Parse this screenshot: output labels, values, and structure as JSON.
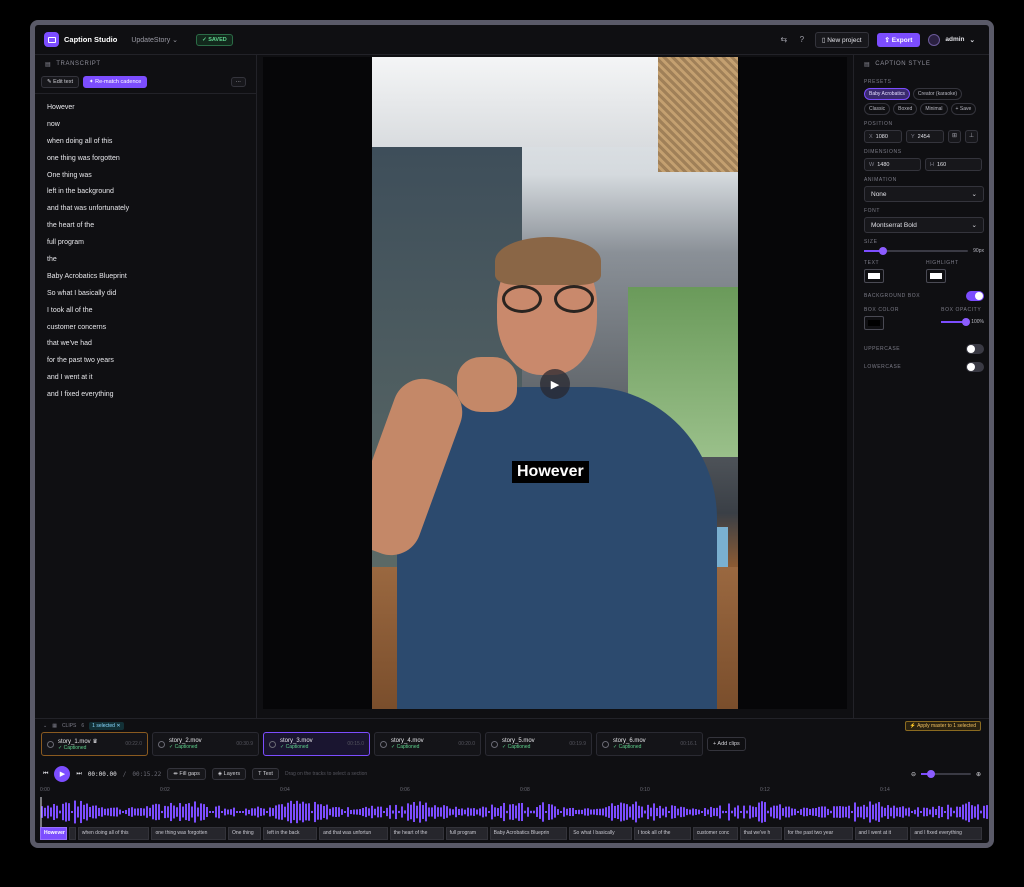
{
  "app": {
    "name": "Caption Studio",
    "project": "UpdateStory ⌄",
    "saved": "✓ SAVED"
  },
  "topbar": {
    "new_project": "New project",
    "export": "Export",
    "user": "admin"
  },
  "transcript": {
    "title": "TRANSCRIPT",
    "edit_text": "Edit text",
    "rematch": "Re-match cadence",
    "more": "···",
    "lines": [
      "However",
      "now",
      "when doing all of this",
      "one thing was forgotten",
      "One thing was",
      "left in the background",
      "and that was unfortunately",
      "the heart of the",
      "full program",
      "the",
      "Baby Acrobatics Blueprint",
      "So what I basically did",
      "I took all of the",
      "customer concerns",
      "that we've had",
      "for the past two years",
      "and I went at it",
      "and I fixed everything"
    ]
  },
  "video": {
    "caption": "However"
  },
  "style": {
    "title": "CAPTION STYLE",
    "presets_label": "PRESETS",
    "presets": [
      "Baby Acrobatics",
      "Creator (karaoke)",
      "Classic",
      "Boxed",
      "Minimal",
      "+ Save"
    ],
    "position_label": "POSITION",
    "pos_x_key": "X",
    "pos_x": "1080",
    "pos_y_key": "Y",
    "pos_y": "2454",
    "dimensions_label": "DIMENSIONS",
    "dim_w_key": "W",
    "dim_w": "1480",
    "dim_h_key": "H",
    "dim_h": "160",
    "animation_label": "ANIMATION",
    "animation": "None",
    "font_label": "FONT",
    "font": "Montserrat Bold",
    "size_label": "SIZE",
    "size": "90px",
    "size_level": 0.18,
    "text_label": "TEXT",
    "text_color": "#ffffff",
    "highlight_label": "HIGHLIGHT",
    "highlight_color": "#ffffff",
    "bg_box_label": "BACKGROUND BOX",
    "bg_box_on": true,
    "box_color_label": "BOX COLOR",
    "box_color": "#000000",
    "box_opacity_label": "BOX OPACITY",
    "box_opacity": "100%",
    "box_opacity_level": 1.0,
    "uppercase_label": "UPPERCASE",
    "lowercase_label": "LOWERCASE"
  },
  "clips": {
    "label": "CLIPS",
    "count": "6",
    "selected": "1 selected ✕",
    "apply": "⚡ Apply master to 1 selected",
    "items": [
      {
        "name": "story_1.mov ♛",
        "status": "✓ Captioned",
        "time": "00:22.0"
      },
      {
        "name": "story_2.mov",
        "status": "✓ Captioned",
        "time": "00:30.9"
      },
      {
        "name": "story_3.mov",
        "status": "✓ Captioned",
        "time": "00:15.0"
      },
      {
        "name": "story_4.mov",
        "status": "✓ Captioned",
        "time": "00:20.0"
      },
      {
        "name": "story_5.mov",
        "status": "✓ Captioned",
        "time": "00:19.9"
      },
      {
        "name": "story_6.mov",
        "status": "✓ Captioned",
        "time": "00:16.1"
      }
    ],
    "add": "+ Add clips"
  },
  "transport": {
    "time": "00:00.00",
    "sep": "/",
    "duration": "00:15.22",
    "fill_gaps": "Fill gaps",
    "layers": "Layers",
    "text": "Text",
    "hint": "Drag on the tracks to select a section",
    "zoom_level": 0.2
  },
  "ruler": [
    "0:00",
    "0:02",
    "0:04",
    "0:06",
    "0:08",
    "0:10",
    "0:12",
    "0:14"
  ],
  "segments": [
    "However",
    "",
    "when doing all of this",
    "one thing was forgotten",
    "One thing",
    "left in the back",
    "and that was unfortun",
    "the heart of the",
    "full program",
    "Baby Acrobatics Blueprin",
    "So what I basically",
    "I took all of the",
    "customer conc",
    "that we've h",
    "for the past two year",
    "and I went at it",
    "and I fixed everything"
  ]
}
